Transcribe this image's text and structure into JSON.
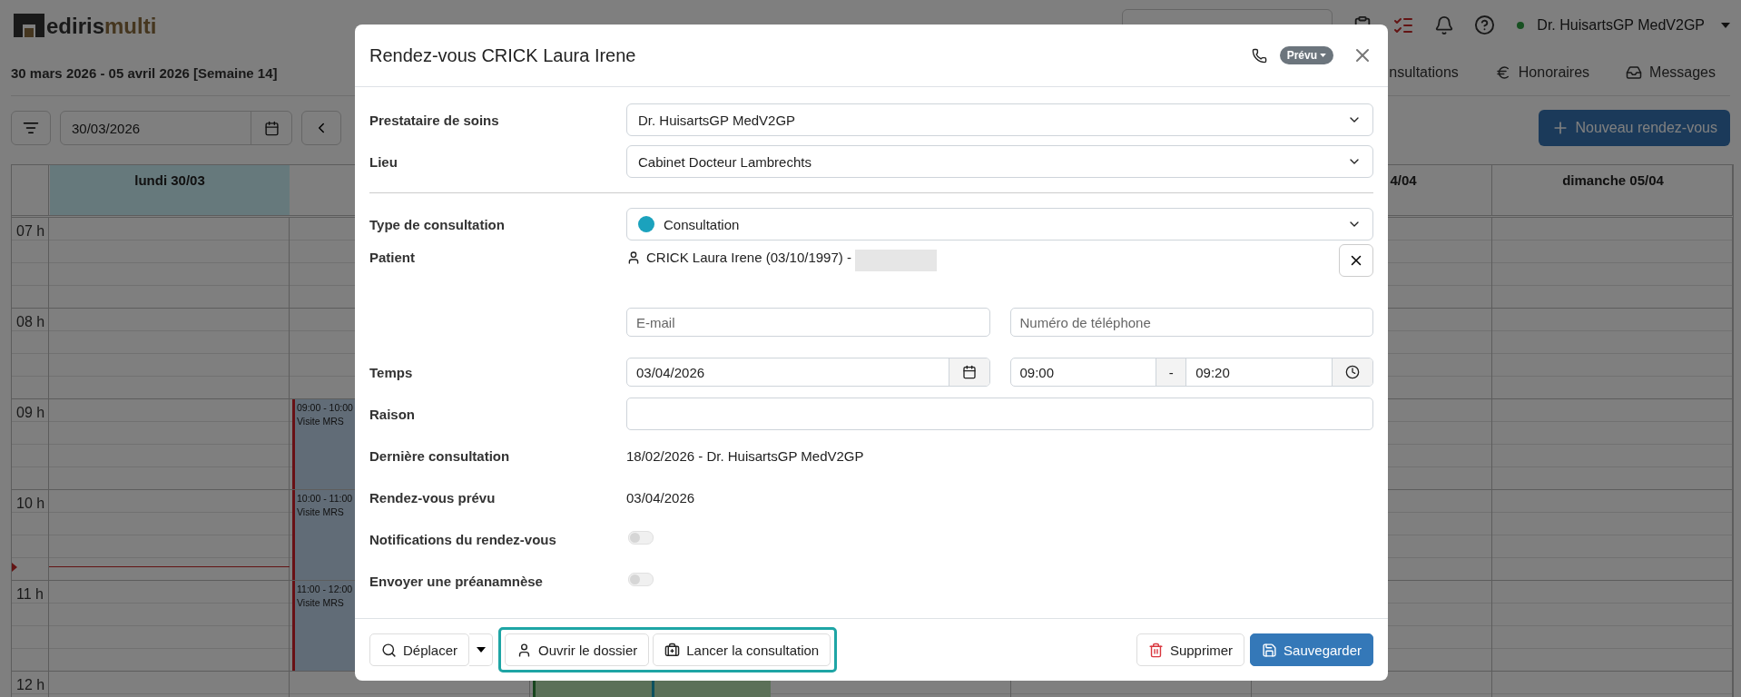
{
  "header": {
    "logo": {
      "first": "ediris",
      "second": "multi"
    },
    "user": {
      "name": "Dr. HuisartsGP MedV2GP",
      "online": true
    }
  },
  "nav": {
    "week": "30 mars 2026 - 05 avril 2026 [Semaine 14]",
    "tabs": [
      {
        "label": "nsultations"
      },
      {
        "label": "Honoraires"
      },
      {
        "label": "Messages"
      }
    ]
  },
  "toolbar": {
    "date": "30/03/2026",
    "new_button": "Nouveau rendez-vous"
  },
  "calendar": {
    "days": [
      {
        "header": "lundi 30/03",
        "today": true
      },
      {
        "header": "4/04",
        "today": false
      },
      {
        "header": "dimanche 05/04",
        "today": false
      }
    ],
    "rows": [
      {
        "label": "07 h"
      },
      {
        "label": "08 h"
      },
      {
        "label": "09 h",
        "cells": [
          {},
          {
            "events": [
              {
                "kind": "visit",
                "time": "09:00 - 10:00",
                "title": "Visite MRS"
              }
            ]
          }
        ]
      },
      {
        "label": "10 h",
        "cells": [
          {},
          {
            "events": [
              {
                "kind": "visit",
                "time": "10:00 - 11:00",
                "title": "Visite MRS"
              }
            ]
          }
        ]
      },
      {
        "label": "11 h",
        "cells": [
          {},
          {
            "events": [
              {
                "kind": "visit",
                "time": "11:00 - 12:00",
                "title": "Visite MRS"
              }
            ]
          }
        ]
      },
      {
        "label": "12 h",
        "cells": [
          {},
          {},
          {
            "events": [
              {
                "kind": "home"
              },
              {
                "kind": "consult"
              }
            ]
          }
        ]
      }
    ]
  },
  "modal": {
    "title": "Rendez-vous CRICK Laura Irene",
    "status": "Prévu",
    "rows": [
      {
        "kind": "select",
        "label": "Prestataire de soins",
        "value": "Dr. HuisartsGP MedV2GP"
      },
      {
        "kind": "select",
        "label": "Lieu",
        "value": "Cabinet Docteur Lambrechts"
      },
      {
        "kind": "divider"
      },
      {
        "kind": "select",
        "label": "Type de consultation",
        "value": "Consultation",
        "color": "#1ba2bd"
      },
      {
        "kind": "patient",
        "label": "Patient",
        "value": "CRICK Laura Irene (03/10/1997) -",
        "redacted": true
      },
      {
        "kind": "contact",
        "fields": [
          {
            "placeholder": "E-mail"
          },
          {
            "placeholder": "Numéro de téléphone"
          }
        ]
      },
      {
        "kind": "datetime",
        "label": "Temps",
        "date": "03/04/2026",
        "start": "09:00",
        "separator": "-",
        "end": "09:20"
      },
      {
        "kind": "input",
        "label": "Raison"
      },
      {
        "kind": "text",
        "label": "Dernière consultation",
        "value": "18/02/2026 - Dr. HuisartsGP MedV2GP"
      },
      {
        "kind": "text",
        "label": "Rendez-vous prévu",
        "value": "03/04/2026"
      },
      {
        "kind": "toggle",
        "label": "Notifications du rendez-vous",
        "on": false
      },
      {
        "kind": "toggle",
        "label": "Envoyer une préanamnèse",
        "on": false
      }
    ],
    "footer": {
      "left": [
        {
          "kind": "split",
          "label": "Déplacer",
          "highlighted": false
        },
        {
          "kind": "outline",
          "label": "Ouvrir le dossier",
          "highlighted": true
        },
        {
          "kind": "outline",
          "label": "Lancer la consultation",
          "highlighted": true
        }
      ],
      "right": [
        {
          "kind": "danger",
          "label": "Supprimer"
        },
        {
          "kind": "primary",
          "label": "Sauvegarder"
        }
      ]
    }
  }
}
